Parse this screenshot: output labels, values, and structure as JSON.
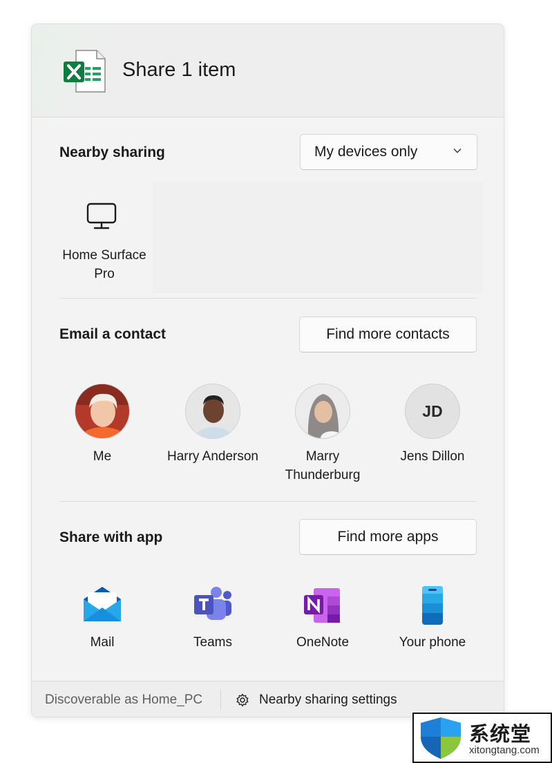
{
  "header": {
    "title": "Share 1 item",
    "file_icon": "excel-file-icon"
  },
  "nearby": {
    "title": "Nearby sharing",
    "dropdown_value": "My devices only",
    "devices": [
      {
        "label": "Home Surface Pro",
        "icon": "monitor-icon"
      }
    ]
  },
  "email": {
    "title": "Email a contact",
    "find_button": "Find more contacts",
    "contacts": [
      {
        "name": "Me"
      },
      {
        "name": "Harry Anderson"
      },
      {
        "name": "Marry Thunderburg"
      },
      {
        "name": "Jens Dillon",
        "initials": "JD"
      }
    ]
  },
  "apps": {
    "title": "Share with app",
    "find_button": "Find more apps",
    "items": [
      {
        "label": "Mail",
        "icon": "mail-icon"
      },
      {
        "label": "Teams",
        "icon": "teams-icon"
      },
      {
        "label": "OneNote",
        "icon": "onenote-icon"
      },
      {
        "label": "Your phone",
        "icon": "phone-icon"
      }
    ]
  },
  "footer": {
    "discoverable": "Discoverable as Home_PC",
    "settings_link": "Nearby sharing settings"
  },
  "watermark": {
    "name": "系统堂",
    "url": "xitongtang.com"
  },
  "colors": {
    "panel_bg": "#f3f3f3",
    "excel_green": "#107c41",
    "teams_purple": "#5b5fc7",
    "onenote_purple": "#7719aa",
    "mail_blue": "#1490df"
  }
}
